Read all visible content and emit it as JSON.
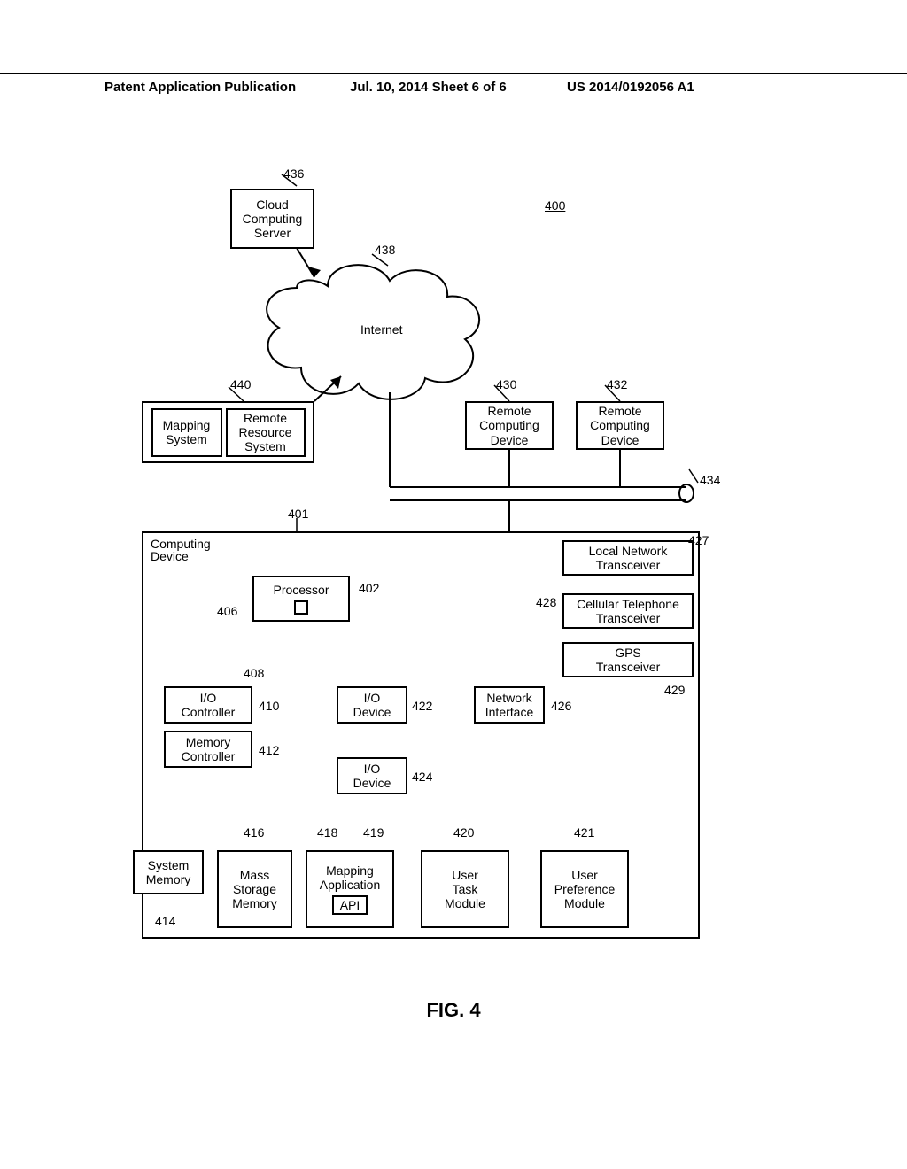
{
  "header": {
    "left": "Patent Application Publication",
    "mid": "Jul. 10, 2014  Sheet 6 of 6",
    "right": "US 2014/0192056 A1"
  },
  "fig": {
    "label": "FIG. 4",
    "ref_400": "400",
    "ref_401": "401",
    "ref_402": "402",
    "ref_406": "406",
    "ref_408": "408",
    "ref_410": "410",
    "ref_412": "412",
    "ref_414": "414",
    "ref_416": "416",
    "ref_418": "418",
    "ref_419": "419",
    "ref_420": "420",
    "ref_421": "421",
    "ref_422": "422",
    "ref_424": "424",
    "ref_426": "426",
    "ref_427": "427",
    "ref_428": "428",
    "ref_429": "429",
    "ref_430": "430",
    "ref_432": "432",
    "ref_434": "434",
    "ref_436": "436",
    "ref_438": "438",
    "ref_440": "440"
  },
  "blocks": {
    "cloud_server": "Cloud\nComputing\nServer",
    "internet": "Internet",
    "mapping_system": "Mapping\nSystem",
    "remote_resource": "Remote\nResource\nSystem",
    "remote_dev1": "Remote\nComputing\nDevice",
    "remote_dev2": "Remote\nComputing\nDevice",
    "computing_device": "Computing\nDevice",
    "processor": "Processor",
    "local_net": "Local Network\nTransceiver",
    "cell_trans": "Cellular Telephone\nTransceiver",
    "gps_trans": "GPS\nTransceiver",
    "io_controller": "I/O\nController",
    "mem_controller": "Memory\nController",
    "io_dev1": "I/O\nDevice",
    "io_dev2": "I/O\nDevice",
    "net_iface": "Network\nInterface",
    "sys_mem": "System\nMemory",
    "mass_storage": "Mass\nStorage\nMemory",
    "mapping_app": "Mapping\nApplication",
    "api": "API",
    "user_task": "User\nTask\nModule",
    "user_pref": "User\nPreference\nModule"
  }
}
